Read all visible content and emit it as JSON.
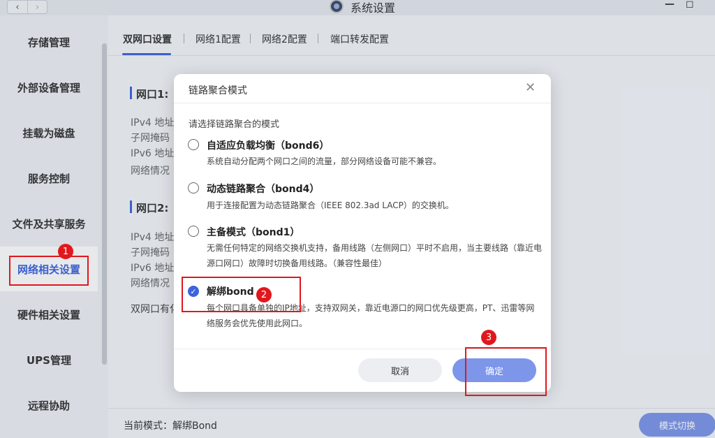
{
  "window": {
    "title": "系统设置",
    "back_icon": "‹",
    "forward_icon": "›",
    "minimize_icon": "—",
    "maximize_icon": "◻"
  },
  "sidebar": {
    "items": [
      {
        "label": "存储管理"
      },
      {
        "label": "外部设备管理"
      },
      {
        "label": "挂载为磁盘"
      },
      {
        "label": "服务控制"
      },
      {
        "label": "文件及共享服务"
      },
      {
        "label": "网络相关设置"
      },
      {
        "label": "硬件相关设置"
      },
      {
        "label": "UPS管理"
      },
      {
        "label": "远程协助"
      }
    ],
    "active_index": 5
  },
  "tabs": [
    "双网口设置",
    "网络1配置",
    "网络2配置",
    "端口转发配置"
  ],
  "sections": [
    {
      "title": "网口1:",
      "rows": [
        "IPv4 地址",
        "子网掩码",
        "IPv6 地址",
        "网络情况"
      ]
    },
    {
      "title": "网口2:",
      "rows": [
        "IPv4 地址",
        "子网掩码",
        "IPv6 地址",
        "网络情况"
      ]
    }
  ],
  "dual_port_note": "双网口有化",
  "footer": {
    "current_mode": "当前模式：解绑Bond",
    "switch_button": "模式切换"
  },
  "modal": {
    "title": "链路聚合模式",
    "close_icon": "✕",
    "prompt": "请选择链路聚合的模式",
    "options": [
      {
        "title": "自适应负载均衡（bond6）",
        "desc": "系统自动分配两个网口之间的流量，部分网络设备可能不兼容。",
        "checked": false
      },
      {
        "title": "动态链路聚合（bond4）",
        "desc": "用于连接配置为动态链路聚合（IEEE 802.3ad LACP）的交换机。",
        "checked": false
      },
      {
        "title": "主备模式（bond1）",
        "desc": "无需任何特定的网络交换机支持，备用线路（左侧网口）平时不启用，当主要线路（靠近电源口网口）故障时切换备用线路。（兼容性最佳）",
        "checked": false
      },
      {
        "title": "解绑bond",
        "desc": "每个网口具备单独的IP地址，支持双网关，靠近电源口的网口优先级更高，PT、迅雷等网络服务会优先使用此网口。",
        "checked": true
      }
    ],
    "check_icon": "✓",
    "cancel": "取消",
    "ok": "确定"
  },
  "annotations": [
    "1",
    "2",
    "3"
  ],
  "colors": {
    "accent": "#3d63dd",
    "button": "#7d96ea",
    "annotation": "#e0181e"
  }
}
